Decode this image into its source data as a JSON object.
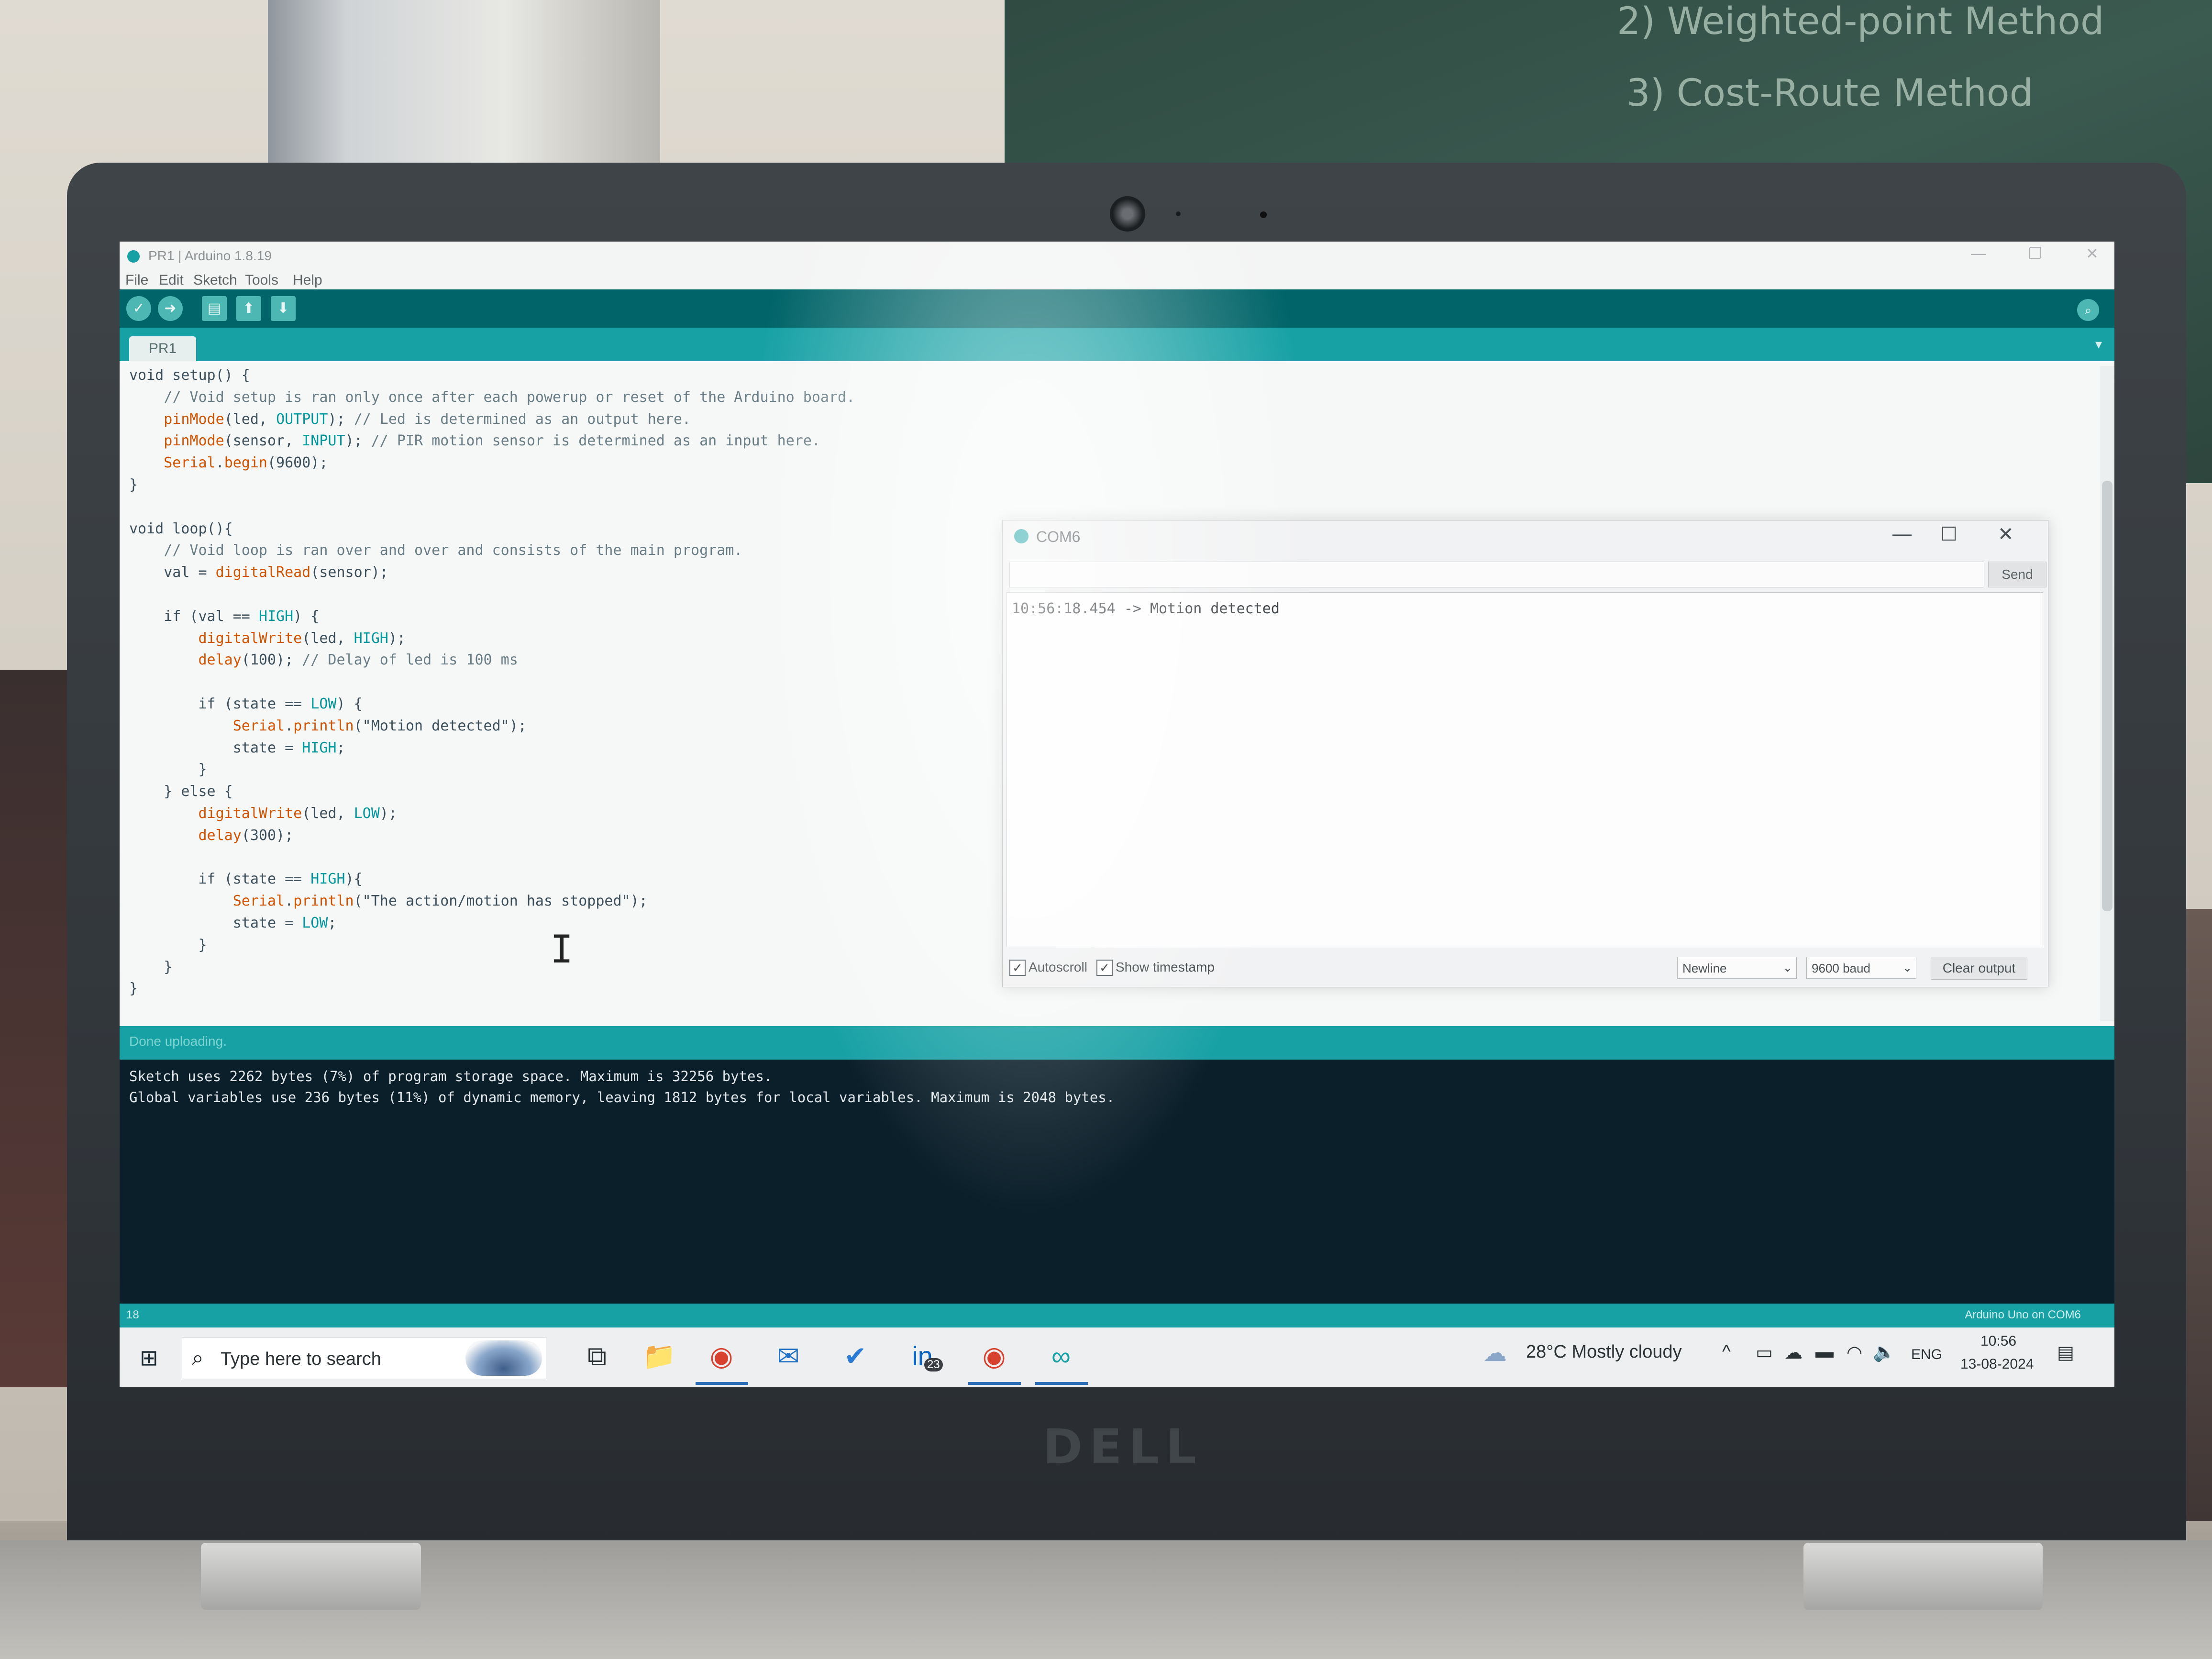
{
  "window": {
    "title": "PR1 | Arduino 1.8.19",
    "controls": [
      "—",
      "❐",
      "✕"
    ]
  },
  "menu": [
    "File",
    "Edit",
    "Sketch",
    "Tools",
    "Help"
  ],
  "toolbar": {
    "buttons": [
      {
        "name": "verify",
        "icon": "check-icon",
        "glyph": "✓"
      },
      {
        "name": "upload",
        "icon": "arrow-right-icon",
        "glyph": "➜"
      },
      {
        "name": "new",
        "icon": "new-file-icon",
        "glyph": "▤"
      },
      {
        "name": "open",
        "icon": "open-arrow-up-icon",
        "glyph": "⬆"
      },
      {
        "name": "save",
        "icon": "save-arrow-down-icon",
        "glyph": "⬇"
      }
    ],
    "serial_monitor_icon": "magnifier-icon",
    "serial_monitor_glyph": "⌕"
  },
  "tabs": [
    "PR1"
  ],
  "code": [
    "void setup() {",
    "    // Void setup is ran only once after each powerup or reset of the Arduino board.",
    "    pinMode(led, OUTPUT); // Led is determined as an output here.",
    "    pinMode(sensor, INPUT); // PIR motion sensor is determined as an input here.",
    "    Serial.begin(9600);",
    "}",
    "",
    "void loop(){",
    "    // Void loop is ran over and over and consists of the main program.",
    "    val = digitalRead(sensor);",
    "",
    "    if (val == HIGH) {",
    "        digitalWrite(led, HIGH);",
    "        delay(100); // Delay of led is 100 ms",
    "",
    "        if (state == LOW) {",
    "            Serial.println(\"Motion detected\");",
    "            state = HIGH;",
    "        }",
    "    } else {",
    "        digitalWrite(led, LOW);",
    "        delay(300);",
    "",
    "        if (state == HIGH){",
    "            Serial.println(\"The action/motion has stopped\");",
    "            state = LOW;",
    "        }",
    "    }",
    "}"
  ],
  "console": {
    "status": "Done uploading.",
    "lines": [
      "Sketch uses 2262 bytes (7%) of program storage space. Maximum is 32256 bytes.",
      "Global variables use 236 bytes (11%) of dynamic memory, leaving 1812 bytes for local variables. Maximum is 2048 bytes."
    ]
  },
  "statusbar": {
    "line_number": "18",
    "board": "Arduino Uno on COM6"
  },
  "serial_monitor": {
    "title": "COM6",
    "send_label": "Send",
    "input_value": "",
    "output_lines": [
      "10:56:18.454 -> Motion detected"
    ],
    "autoscroll_label": "Autoscroll",
    "autoscroll_checked": true,
    "timestamp_label": "Show timestamp",
    "timestamp_checked": true,
    "line_ending": "Newline",
    "baud": "9600 baud",
    "clear_label": "Clear output",
    "controls": [
      "—",
      "☐",
      "✕"
    ]
  },
  "taskbar": {
    "search_placeholder": "Type here to search",
    "apps": [
      {
        "name": "task-view",
        "glyph": "⧉",
        "color": "#2b3236"
      },
      {
        "name": "file-explorer",
        "glyph": "📁",
        "color": "#e3a21a"
      },
      {
        "name": "chrome",
        "glyph": "◉",
        "color": "#d9412f"
      },
      {
        "name": "mail",
        "glyph": "✉",
        "color": "#1f6fc5"
      },
      {
        "name": "todo",
        "glyph": "✔",
        "color": "#2b7bd6"
      },
      {
        "name": "linkedin",
        "glyph": "in",
        "color": "#0a66c2",
        "badge": "23"
      },
      {
        "name": "chrome-profile",
        "glyph": "◉",
        "color": "#d9412f"
      },
      {
        "name": "arduino",
        "glyph": "∞",
        "color": "#17a1a5"
      }
    ],
    "weather": "28°C  Mostly cloudy",
    "language": "ENG",
    "time": "10:56",
    "date": "13-08-2024"
  },
  "laptop_brand": "DELL",
  "board_text": [
    "2) Weighted-point Method",
    "3) Cost-Route Method"
  ]
}
